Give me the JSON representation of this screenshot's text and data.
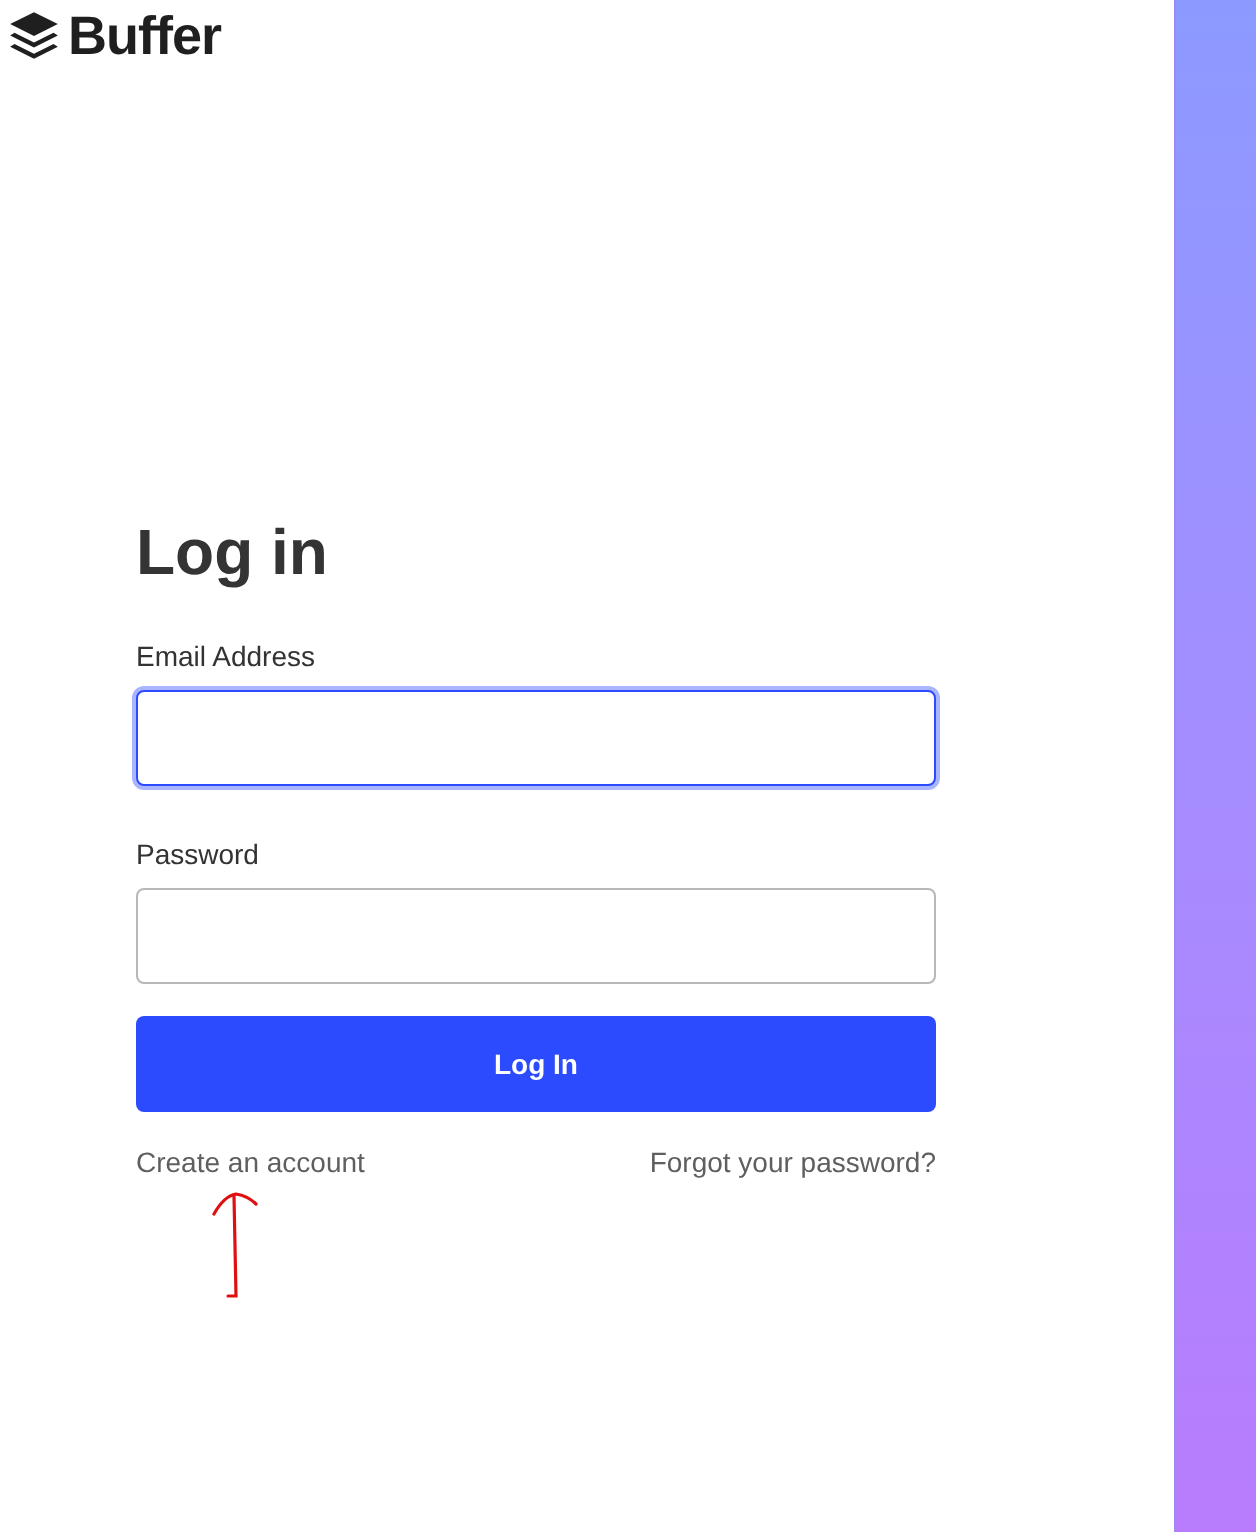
{
  "logo": {
    "text": "Buffer"
  },
  "heading": "Log in",
  "fields": [
    {
      "label": "Email Address",
      "focused": true
    },
    {
      "label": "Password",
      "focused": false
    }
  ],
  "submit": "Log In",
  "links": [
    "Create an account",
    "Forgot your password?"
  ]
}
